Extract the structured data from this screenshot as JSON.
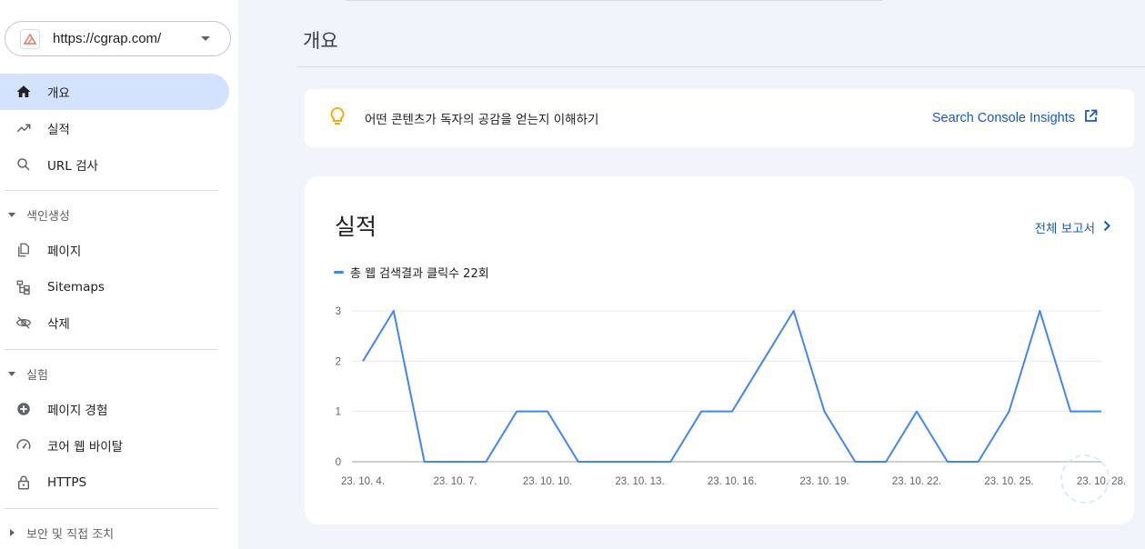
{
  "sidebar": {
    "property_url": "https://cgrap.com/",
    "nav": [
      {
        "label": "개요",
        "icon": "home-icon",
        "active": true
      },
      {
        "label": "실적",
        "icon": "trending-up-icon"
      },
      {
        "label": "URL 검사",
        "icon": "search-icon"
      }
    ],
    "sections": {
      "indexing": {
        "title": "색인생성",
        "items": [
          {
            "label": "페이지",
            "icon": "pages-icon"
          },
          {
            "label": "Sitemaps",
            "icon": "sitemap-icon"
          },
          {
            "label": "삭제",
            "icon": "eye-off-icon"
          }
        ]
      },
      "experience": {
        "title": "실험",
        "items": [
          {
            "label": "페이지 경험",
            "icon": "plus-circle-icon"
          },
          {
            "label": "코어 웹 바이탈",
            "icon": "speedometer-icon"
          },
          {
            "label": "HTTPS",
            "icon": "lock-icon"
          }
        ]
      },
      "security": {
        "title": "보안 및 직접 조치"
      }
    }
  },
  "main": {
    "page_title": "개요",
    "insight": {
      "text": "어떤 콘텐츠가 독자의 공감을 얻는지 이해하기",
      "link_label": "Search Console Insights"
    },
    "performance": {
      "title": "실적",
      "full_report_label": "전체 보고서",
      "legend_label": "총 웹 검색결과 클릭수 22회"
    }
  },
  "colors": {
    "accent": "#1a57c5",
    "series": "#4285f4",
    "active_nav": "#d3e3fd",
    "background": "#f1f4fa",
    "insight_bulb": "#f9ab00"
  },
  "chart_data": {
    "type": "line",
    "x": [
      "23. 10. 4.",
      "23. 10. 5.",
      "23. 10. 6.",
      "23. 10. 7.",
      "23. 10. 8.",
      "23. 10. 9.",
      "23. 10. 10.",
      "23. 10. 11.",
      "23. 10. 12.",
      "23. 10. 13.",
      "23. 10. 14.",
      "23. 10. 15.",
      "23. 10. 16.",
      "23. 10. 17.",
      "23. 10. 18.",
      "23. 10. 19.",
      "23. 10. 20.",
      "23. 10. 21.",
      "23. 10. 22.",
      "23. 10. 23.",
      "23. 10. 24.",
      "23. 10. 25.",
      "23. 10. 26.",
      "23. 10. 27.",
      "23. 10. 28."
    ],
    "series": [
      {
        "name": "총 웹 검색결과 클릭수 22회",
        "values": [
          2,
          3,
          0,
          0,
          0,
          1,
          1,
          0,
          0,
          0,
          0,
          1,
          1,
          2,
          3,
          1,
          0,
          0,
          1,
          0,
          0,
          1,
          3,
          1,
          1
        ]
      }
    ],
    "x_tick_labels": [
      "23. 10. 4.",
      "23. 10. 7.",
      "23. 10. 10.",
      "23. 10. 13.",
      "23. 10. 16.",
      "23. 10. 19.",
      "23. 10. 22.",
      "23. 10. 25.",
      "23. 10. 28."
    ],
    "y_ticks": [
      0,
      1,
      2,
      3
    ],
    "ylim": [
      0,
      3
    ],
    "grid": true
  }
}
